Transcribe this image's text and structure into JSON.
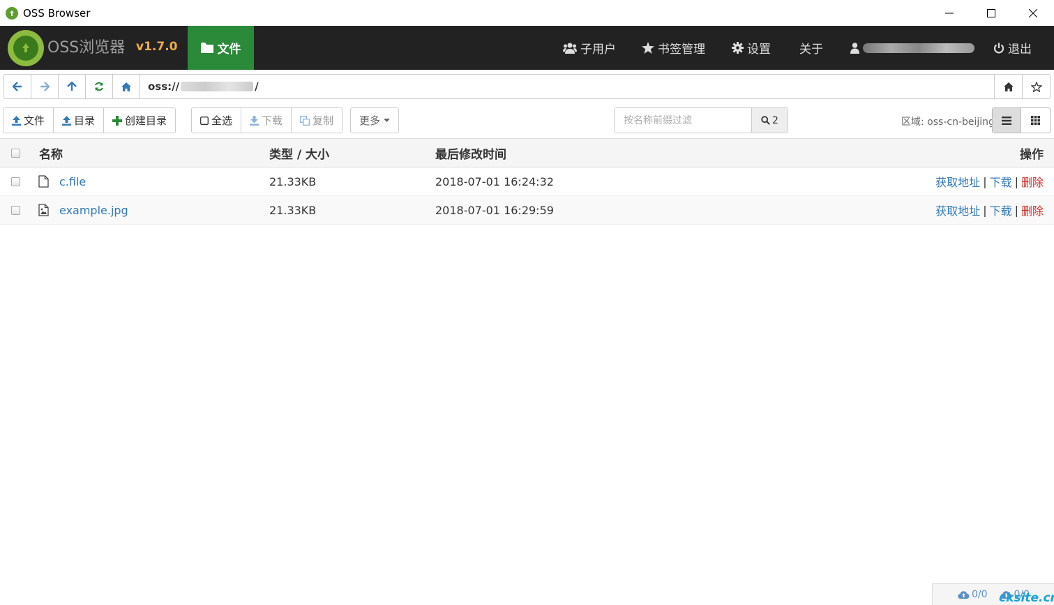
{
  "window": {
    "title": "OSS Browser",
    "minimize_glyph": "—",
    "maximize_glyph": "☐",
    "close_glyph": "✕"
  },
  "navbar": {
    "brand": "OSS浏览器",
    "version": "v1.7.0",
    "files_tab": "文件",
    "sub_users": "子用户",
    "bookmarks": "书签管理",
    "settings": "设置",
    "about": "关于",
    "logout": "退出"
  },
  "address": {
    "prefix": "oss://",
    "suffix": "/"
  },
  "toolbar": {
    "upload_file": "文件",
    "upload_dir": "目录",
    "create_dir": "创建目录",
    "select_all": "全选",
    "download": "下载",
    "copy": "复制",
    "more": "更多"
  },
  "filter": {
    "placeholder": "按名称前缀过滤",
    "count": "2"
  },
  "region": "区域: oss-cn-beijing",
  "table": {
    "headers": {
      "name": "名称",
      "type_size": "类型 / 大小",
      "modified": "最后修改时间",
      "actions": "操作"
    },
    "rows": [
      {
        "name": "c.file",
        "size": "21.33KB",
        "modified": "2018-07-01 16:24:32",
        "icon": "file-icon"
      },
      {
        "name": "example.jpg",
        "size": "21.33KB",
        "modified": "2018-07-01 16:29:59",
        "icon": "image-file-icon"
      }
    ],
    "actions": {
      "get_url": "获取地址",
      "download": "下载",
      "delete": "删除",
      "separator": "|"
    }
  },
  "status": {
    "upload": "0/0",
    "download": "0/0"
  },
  "watermark": "cksite.cn",
  "colors": {
    "nav_bg": "#222222",
    "files_tab_bg": "#2a8a3a",
    "version": "#f0ad4e",
    "link": "#337ab7",
    "delete": "#c9302c"
  }
}
